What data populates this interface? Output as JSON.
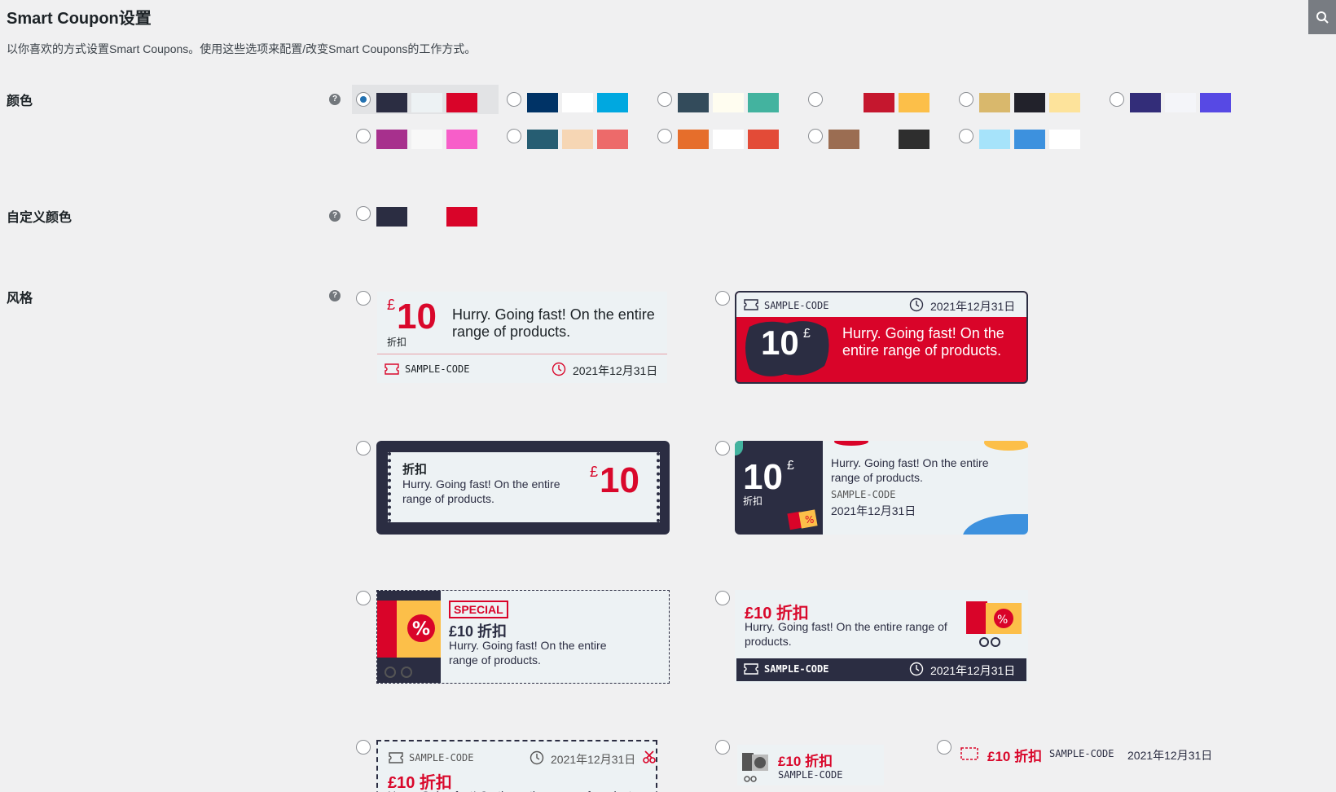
{
  "page": {
    "title": "Smart Coupon设置",
    "description": "以你喜欢的方式设置Smart Coupons。使用这些选项来配置/改变Smart Coupons的工作方式。"
  },
  "search_icon": "search-icon",
  "labels": {
    "color": "颜色",
    "custom_color": "自定义颜色",
    "style": "风格",
    "help_glyph": "?"
  },
  "color_schemes": [
    {
      "colors": [
        "#2b2d42",
        "#edf2f4",
        "#d90429"
      ],
      "selected": true
    },
    {
      "colors": [
        "#003366",
        "#ffffff",
        "#00a8e0"
      ],
      "selected": false
    },
    {
      "colors": [
        "#334b5b",
        "#fffdf0",
        "#43b39f"
      ],
      "selected": false
    },
    {
      "colors": [
        "#f0f0f1",
        "#c5172e",
        "#fcbf49"
      ],
      "selected": false
    },
    {
      "colors": [
        "#d9b86c",
        "#22222b",
        "#fde39b"
      ],
      "selected": false
    },
    {
      "colors": [
        "#332d79",
        "#f4f5f9",
        "#5749e4"
      ],
      "selected": false
    },
    {
      "colors": [
        "#a7308d",
        "#f8f8f8",
        "#f75ec9"
      ],
      "selected": false
    },
    {
      "colors": [
        "#265d72",
        "#f6d6b4",
        "#ed6a6a"
      ],
      "selected": false
    },
    {
      "colors": [
        "#e66e2b",
        "#ffffff",
        "#e34b37"
      ],
      "selected": false
    },
    {
      "colors": [
        "#9b6d52",
        "#f0f0f1",
        "#2e2e2e"
      ],
      "selected": false
    },
    {
      "colors": [
        "#a6e3fa",
        "#3d91de",
        "#ffffff"
      ],
      "selected": false
    }
  ],
  "custom_colors": [
    "#2b2d42",
    "#f0f0f1",
    "#d90429"
  ],
  "coupon": {
    "currency": "£",
    "amount": "10",
    "discount": "折扣",
    "amount_discount": "£10 折扣",
    "description": "Hurry. Going fast! On the entire range of products.",
    "code": "SAMPLE-CODE",
    "expiry": "2021年12月31日",
    "special": "SPECIAL"
  }
}
